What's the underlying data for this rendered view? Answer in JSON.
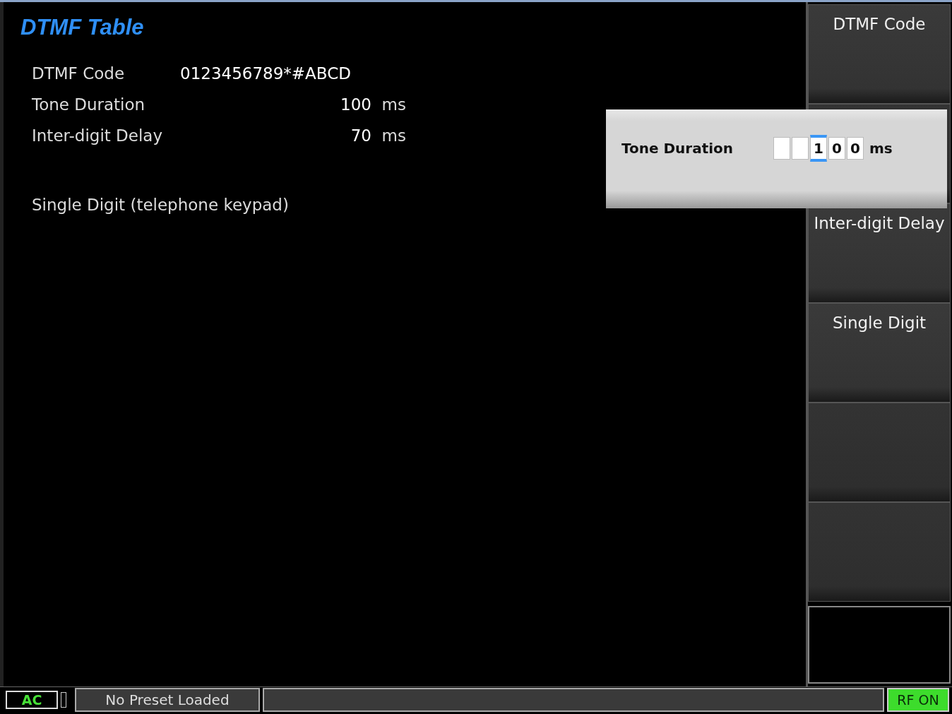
{
  "title": "DTMF Table",
  "settings": [
    {
      "label": "DTMF Code",
      "value": "0123456789*#ABCD",
      "kind": "text"
    },
    {
      "label": "Tone Duration",
      "value": "100",
      "unit": "ms",
      "kind": "number"
    },
    {
      "label": "Inter-digit Delay",
      "value": "70",
      "unit": "ms",
      "kind": "number"
    }
  ],
  "mode": "Single Digit (telephone keypad)",
  "editor": {
    "label": "Tone Duration",
    "unit": "ms",
    "cells": [
      {
        "kind": "empty",
        "selected": false
      },
      {
        "kind": "empty",
        "selected": false
      },
      {
        "kind": "digit",
        "value": "1",
        "selected": true
      },
      {
        "kind": "digit",
        "value": "0",
        "selected": false
      },
      {
        "kind": "digit",
        "value": "0",
        "selected": false
      }
    ]
  },
  "softkeys": [
    {
      "kind": "label",
      "label": "DTMF Code"
    },
    {
      "kind": "blank"
    },
    {
      "kind": "label",
      "label": "Inter-digit Delay"
    },
    {
      "kind": "label",
      "label": "Single Digit"
    },
    {
      "kind": "blank"
    },
    {
      "kind": "blank"
    }
  ],
  "status_bar": {
    "power": "AC",
    "preset": "No Preset Loaded",
    "rf": "RF ON",
    "rf_on": true
  }
}
